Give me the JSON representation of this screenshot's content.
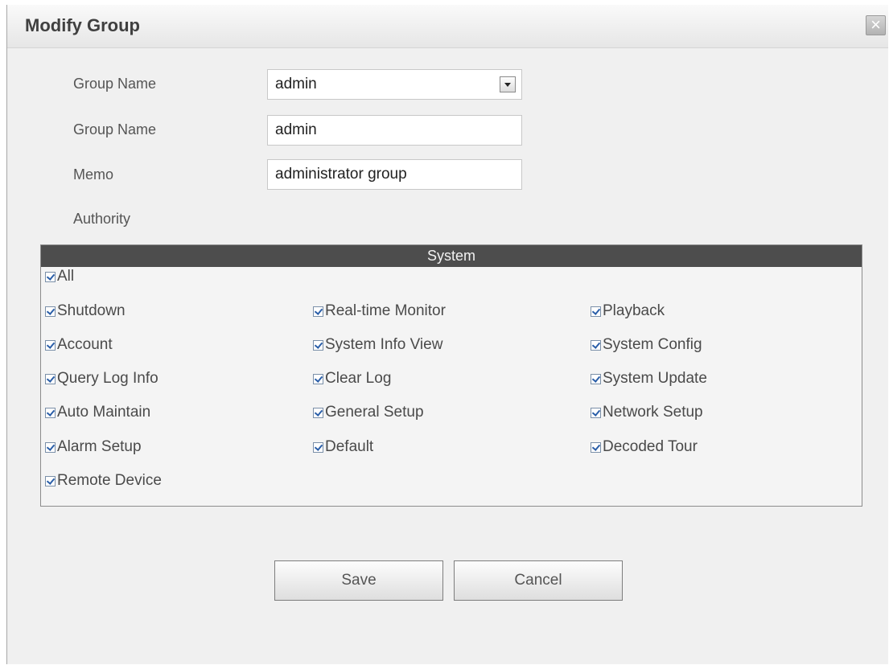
{
  "dialog": {
    "title": "Modify Group",
    "close_symbol": "×"
  },
  "form": {
    "group_select_label": "Group Name",
    "group_select_value": "admin",
    "group_name_label": "Group Name",
    "group_name_value": "admin",
    "memo_label": "Memo",
    "memo_value": "administrator group",
    "authority_label": "Authority"
  },
  "permissions": {
    "header": "System",
    "all": {
      "label": "All",
      "checked": true
    },
    "rows": [
      [
        {
          "label": "Shutdown",
          "checked": true
        },
        {
          "label": "Real-time Monitor",
          "checked": true
        },
        {
          "label": "Playback",
          "checked": true
        }
      ],
      [
        {
          "label": "Account",
          "checked": true
        },
        {
          "label": "System Info View",
          "checked": true
        },
        {
          "label": "System Config",
          "checked": true
        }
      ],
      [
        {
          "label": "Query Log Info",
          "checked": true
        },
        {
          "label": "Clear Log",
          "checked": true
        },
        {
          "label": "System Update",
          "checked": true
        }
      ],
      [
        {
          "label": "Auto Maintain",
          "checked": true
        },
        {
          "label": "General Setup",
          "checked": true
        },
        {
          "label": "Network Setup",
          "checked": true
        }
      ],
      [
        {
          "label": "Alarm Setup",
          "checked": true
        },
        {
          "label": "Default",
          "checked": true
        },
        {
          "label": "Decoded Tour",
          "checked": true
        }
      ],
      [
        {
          "label": "Remote Device",
          "checked": true
        }
      ]
    ]
  },
  "buttons": {
    "save": "Save",
    "cancel": "Cancel"
  },
  "icons": {
    "close": "close-icon",
    "dropdown": "chevron-down-icon",
    "checkbox": "checkmark-icon"
  }
}
